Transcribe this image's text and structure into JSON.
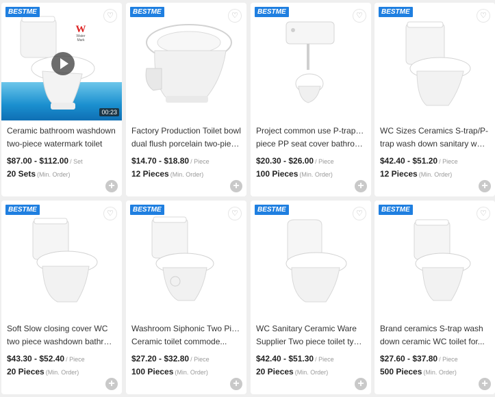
{
  "products": [
    {
      "brand": "BESTME",
      "title_line1": "Ceramic bathroom washdown",
      "title_line2": "two-piece watermark toilet",
      "price": "$87.00 - $112.00",
      "price_unit": "/ Set",
      "moq": "20 Sets",
      "moq_note": "(Min. Order)",
      "video_duration": "00:23",
      "watermark_text": "Water Mark"
    },
    {
      "brand": "BESTME",
      "title_line1": "Factory Production Toilet bowl",
      "title_line2": "dual flush porcelain two-piece...",
      "price": "$14.70 - $18.80",
      "price_unit": "/ Piece",
      "moq": "12 Pieces",
      "moq_note": "(Min. Order)"
    },
    {
      "brand": "BESTME",
      "title_line1": "Project common use P-trap two",
      "title_line2": "piece PP seat cover bathroom...",
      "price": "$20.30 - $26.00",
      "price_unit": "/ Piece",
      "moq": "100 Pieces",
      "moq_note": "(Min. Order)"
    },
    {
      "brand": "BESTME",
      "title_line1": "WC Sizes Ceramics S-trap/P-",
      "title_line2": "trap wash down sanitary ware...",
      "price": "$42.40 - $51.20",
      "price_unit": "/ Piece",
      "moq": "12 Pieces",
      "moq_note": "(Min. Order)"
    },
    {
      "brand": "BESTME",
      "title_line1": "Soft Slow closing cover WC",
      "title_line2": "two piece washdown bathroo...",
      "price": "$43.30 - $52.40",
      "price_unit": "/ Piece",
      "moq": "20 Pieces",
      "moq_note": "(Min. Order)"
    },
    {
      "brand": "BESTME",
      "title_line1": "Washroom Siphonic Two Piece",
      "title_line2": "Ceramic toilet commode...",
      "price": "$27.20 - $32.80",
      "price_unit": "/ Piece",
      "moq": "100 Pieces",
      "moq_note": "(Min. Order)"
    },
    {
      "brand": "BESTME",
      "title_line1": "WC Sanitary Ceramic Ware",
      "title_line2": "Supplier Two piece toilet type...",
      "price": "$42.40 - $51.30",
      "price_unit": "/ Piece",
      "moq": "20 Pieces",
      "moq_note": "(Min. Order)"
    },
    {
      "brand": "BESTME",
      "title_line1": "Brand ceramics S-trap wash",
      "title_line2": "down ceramic WC toilet for...",
      "price": "$27.60 - $37.80",
      "price_unit": "/ Piece",
      "moq": "500 Pieces",
      "moq_note": "(Min. Order)"
    }
  ],
  "icons": {
    "favorite": "heart-icon",
    "add": "plus-circle-icon",
    "play": "play-icon"
  },
  "colors": {
    "brand_badge": "#1f7fe0",
    "background": "#efefef",
    "add_button": "#c9c9c9"
  }
}
